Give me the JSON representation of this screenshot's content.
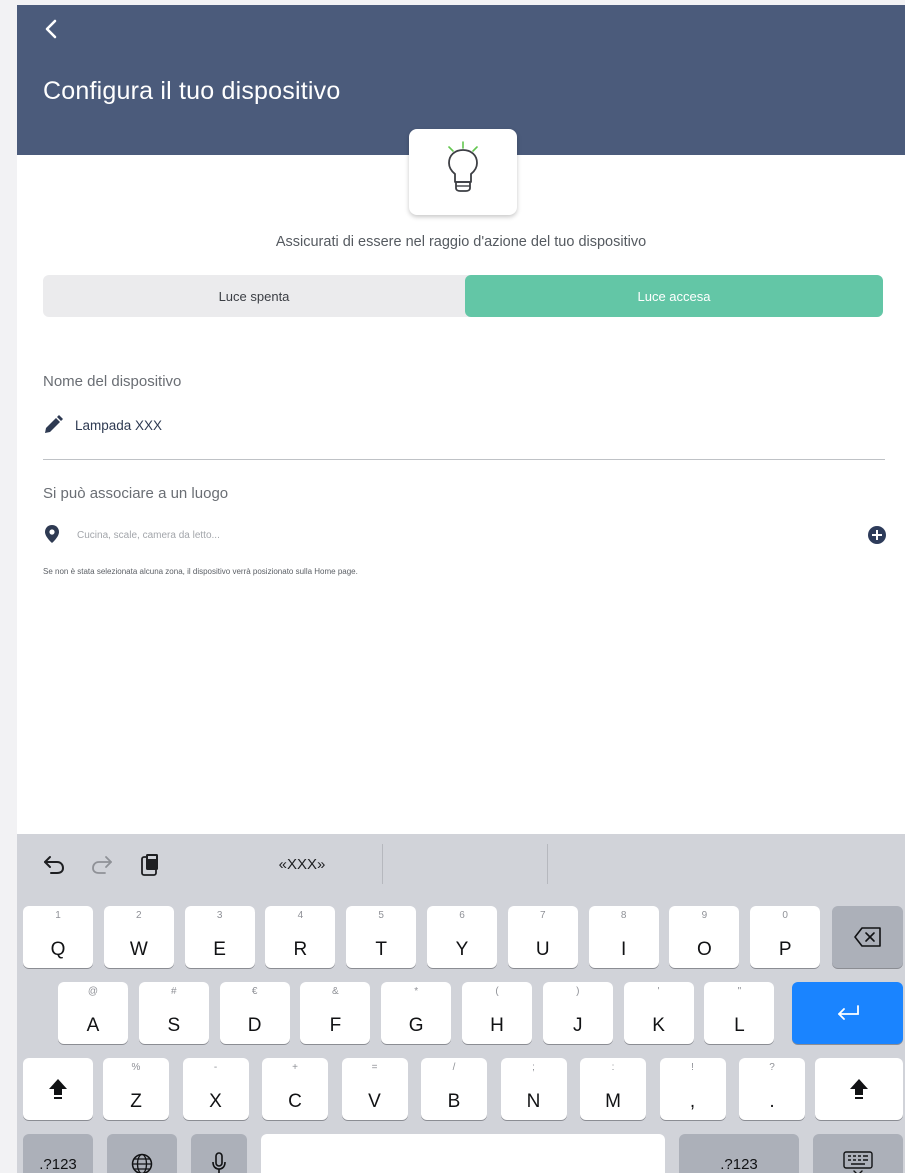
{
  "header": {
    "back_icon": "chevron-left-icon",
    "title": "Configura il tuo dispositivo",
    "bulb_icon": "lightbulb-icon",
    "color": "#4b5b7b"
  },
  "hint": "Assicurati di essere nel raggio d'azione del tuo dispositivo",
  "light_toggle": {
    "off_label": "Luce spenta",
    "on_label": "Luce accesa",
    "selected": "Luce accesa",
    "active_color": "#63c6a6"
  },
  "device_name": {
    "label": "Nome del dispositivo",
    "icon": "pencil-icon",
    "value": "Lampada XXX"
  },
  "location": {
    "label": "Si può associare a un luogo",
    "icon": "map-pin-icon",
    "placeholder": "Cucina, scale, camera da letto...",
    "add_icon": "plus-circle-icon",
    "note": "Se non è stata selezionata alcuna zona, il dispositivo verrà posizionato sulla Home page."
  },
  "keyboard": {
    "toolbar": {
      "undo_icon": "undo-icon",
      "redo_icon": "redo-icon",
      "paste_icon": "clipboard-icon",
      "suggestion": "«XXX»"
    },
    "row1": [
      {
        "sub": "1",
        "main": "Q"
      },
      {
        "sub": "2",
        "main": "W"
      },
      {
        "sub": "3",
        "main": "E"
      },
      {
        "sub": "4",
        "main": "R"
      },
      {
        "sub": "5",
        "main": "T"
      },
      {
        "sub": "6",
        "main": "Y"
      },
      {
        "sub": "7",
        "main": "U"
      },
      {
        "sub": "8",
        "main": "I"
      },
      {
        "sub": "9",
        "main": "O"
      },
      {
        "sub": "0",
        "main": "P"
      }
    ],
    "row2": [
      {
        "sub": "@",
        "main": "A"
      },
      {
        "sub": "#",
        "main": "S"
      },
      {
        "sub": "€",
        "main": "D"
      },
      {
        "sub": "&",
        "main": "F"
      },
      {
        "sub": "*",
        "main": "G"
      },
      {
        "sub": "(",
        "main": "H"
      },
      {
        "sub": ")",
        "main": "J"
      },
      {
        "sub": "'",
        "main": "K"
      },
      {
        "sub": "\"",
        "main": "L"
      }
    ],
    "row3": [
      {
        "sub": "%",
        "main": "Z"
      },
      {
        "sub": "-",
        "main": "X"
      },
      {
        "sub": "+",
        "main": "C"
      },
      {
        "sub": "=",
        "main": "V"
      },
      {
        "sub": "/",
        "main": "B"
      },
      {
        "sub": ";",
        "main": "N"
      },
      {
        "sub": ":",
        "main": "M"
      },
      {
        "sub": "!",
        "main": ","
      },
      {
        "sub": "?",
        "main": "."
      }
    ],
    "numbers_label_left": ".?123",
    "numbers_label_right": ".?123",
    "backspace_icon": "backspace-icon",
    "return_icon": "return-icon",
    "shift_icon": "shift-icon",
    "globe_icon": "globe-icon",
    "mic_icon": "microphone-icon",
    "dismiss_icon": "keyboard-dismiss-icon",
    "return_color": "#1a84ff"
  }
}
